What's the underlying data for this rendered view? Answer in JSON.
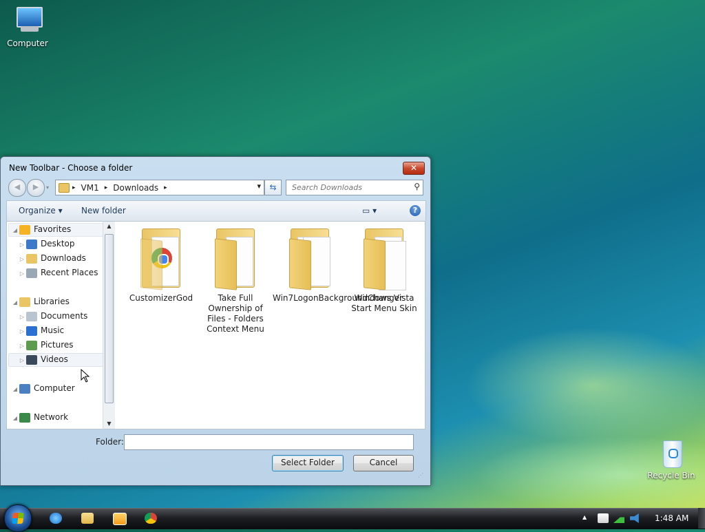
{
  "desktop": {
    "computer_label": "Computer",
    "recycle_label": "Recycle Bin"
  },
  "dialog": {
    "title": "New Toolbar - Choose a folder",
    "close_glyph": "✕",
    "back_glyph": "◀",
    "forward_glyph": "▶",
    "address": {
      "segments": [
        "VM1",
        "Downloads"
      ],
      "separator": "▸",
      "dropdown_glyph": "▾",
      "refresh_glyph": "⇆"
    },
    "search": {
      "placeholder": "Search Downloads",
      "icon": "magnifier-icon",
      "glyph": "⚲"
    },
    "toolbar": {
      "organize": "Organize ▾",
      "new_folder": "New folder",
      "views_glyph": "▭ ▾",
      "help_glyph": "?"
    },
    "nav": [
      {
        "label": "Favorites",
        "icon": "star-icon",
        "indent": 0,
        "color": "#f5b324"
      },
      {
        "label": "Desktop",
        "icon": "desktop-icon",
        "indent": 1,
        "color": "#3c79c9"
      },
      {
        "label": "Downloads",
        "icon": "downloads-folder-icon",
        "indent": 1,
        "color": "#e9c565"
      },
      {
        "label": "Recent Places",
        "icon": "recent-places-icon",
        "indent": 1,
        "color": "#9aa7b5"
      },
      {
        "label": "Libraries",
        "icon": "libraries-icon",
        "indent": 0,
        "color": "#e9c565"
      },
      {
        "label": "Documents",
        "icon": "documents-icon",
        "indent": 1,
        "color": "#b8c4d0"
      },
      {
        "label": "Music",
        "icon": "music-icon",
        "indent": 1,
        "color": "#2b6fd0"
      },
      {
        "label": "Pictures",
        "icon": "pictures-icon",
        "indent": 1,
        "color": "#5d9c4e"
      },
      {
        "label": "Videos",
        "icon": "videos-icon",
        "indent": 1,
        "color": "#3a4a5a"
      },
      {
        "label": "Computer",
        "icon": "computer-icon",
        "indent": 0,
        "color": "#4a7fc0"
      },
      {
        "label": "Network",
        "icon": "network-icon",
        "indent": 0,
        "color": "#3c8a4a"
      }
    ],
    "folders": [
      {
        "label": "CustomizerGod"
      },
      {
        "label": "Take Full Ownership of Files - Folders Context Menu"
      },
      {
        "label": "Win7LogonBackgroundChanger"
      },
      {
        "label": "Windows Vista Start Menu Skin"
      }
    ],
    "folder_label": "Folder:",
    "folder_value": "",
    "select_button": "Select Folder",
    "cancel_button": "Cancel"
  },
  "taskbar": {
    "start_icon": "windows-orb-icon",
    "quick_launch": [
      "internet-explorer-icon",
      "windows-explorer-icon",
      "media-player-icon",
      "chrome-icon"
    ],
    "tray_arrow": "▲",
    "tray_icons": [
      "action-center-icon",
      "network-signal-icon",
      "volume-icon"
    ],
    "clock": "1:48 AM"
  },
  "colors": {
    "accent": "#3c7fb1",
    "titlebar": "#c9dff0",
    "close": "#c94a2e"
  }
}
